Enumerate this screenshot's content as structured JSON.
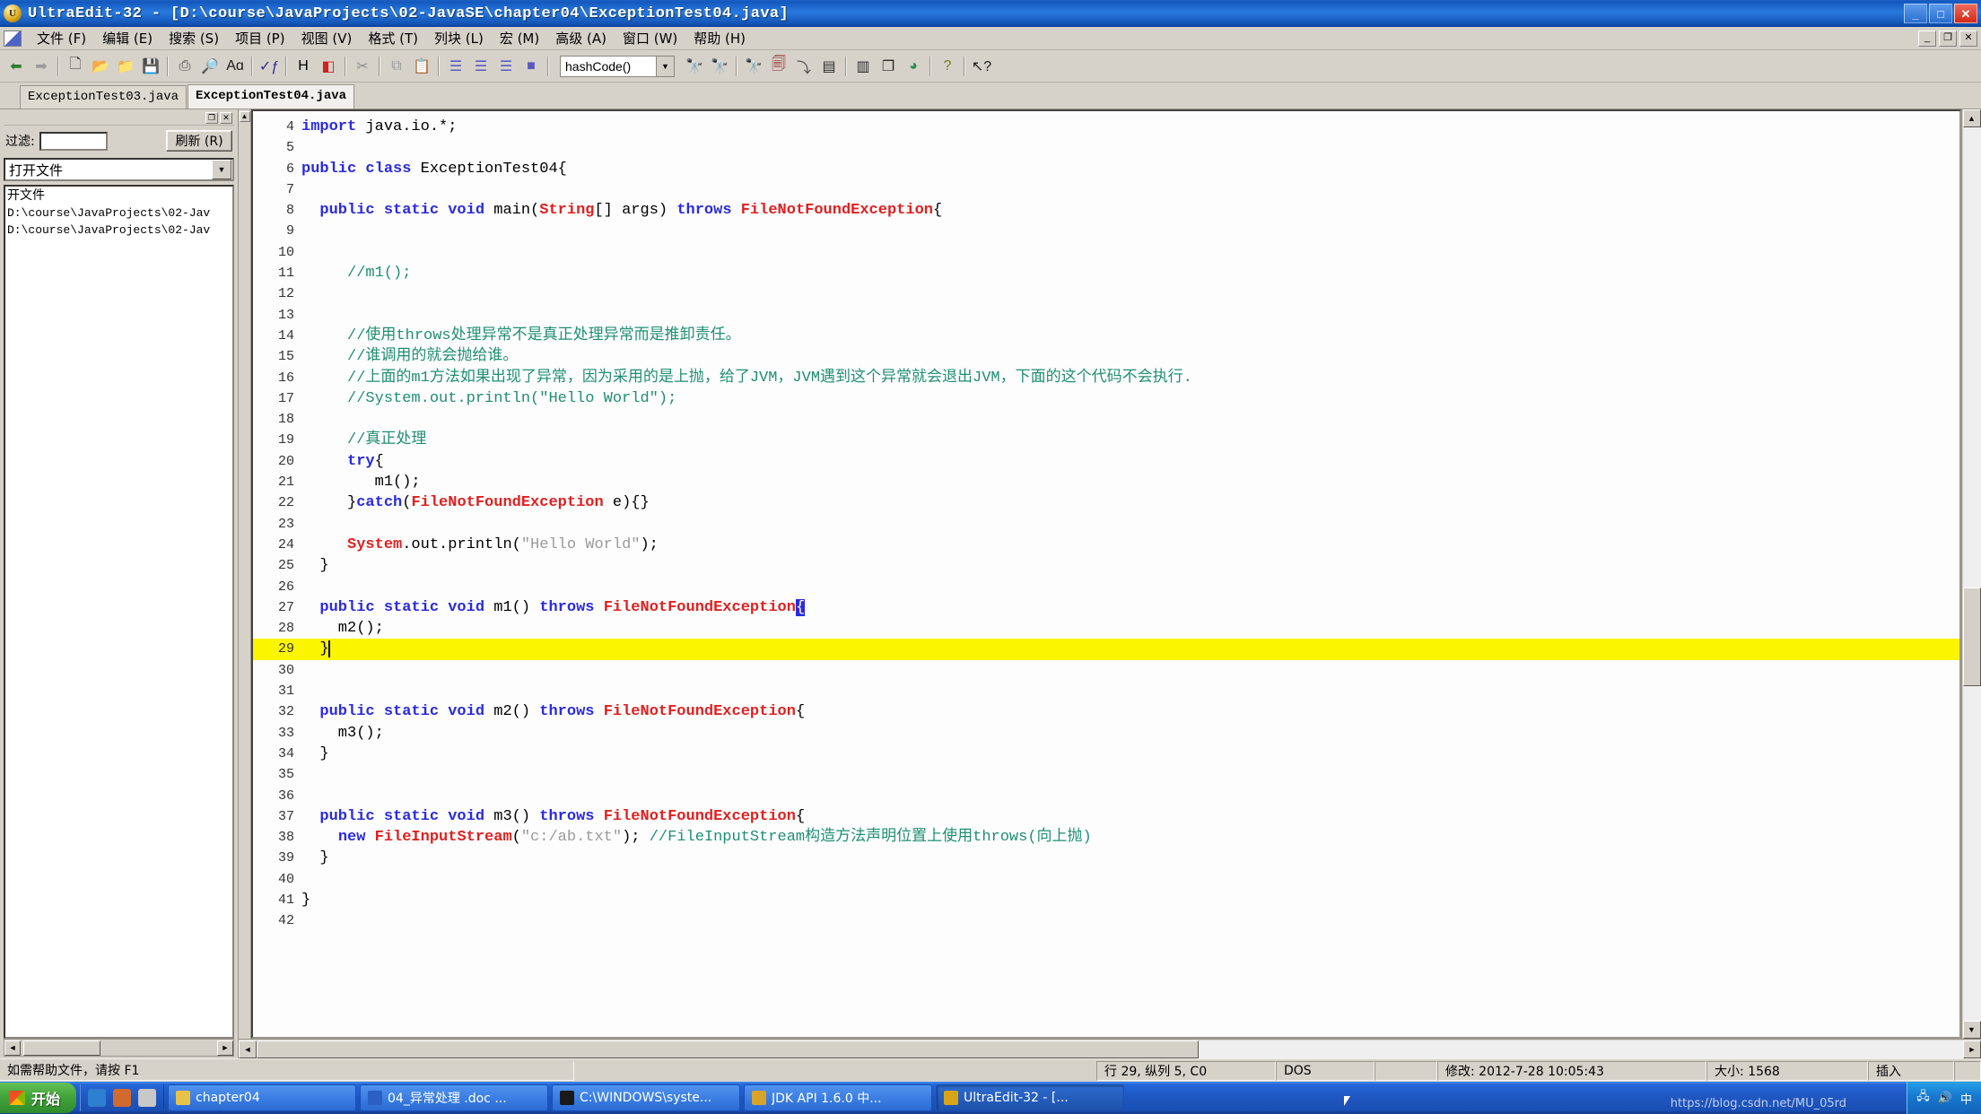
{
  "window": {
    "app_name": "UltraEdit-32",
    "title": "UltraEdit-32 - [D:\\course\\JavaProjects\\02-JavaSE\\chapter04\\ExceptionTest04.java]",
    "minimize_label": "_",
    "maximize_label": "□",
    "close_label": "✕",
    "doc_minimize_label": "_",
    "doc_restore_label": "❐",
    "doc_close_label": "✕"
  },
  "menu": {
    "items": [
      {
        "label": "文件 (F)",
        "name": "menu-file"
      },
      {
        "label": "编辑 (E)",
        "name": "menu-edit"
      },
      {
        "label": "搜索 (S)",
        "name": "menu-search"
      },
      {
        "label": "项目 (P)",
        "name": "menu-project"
      },
      {
        "label": "视图 (V)",
        "name": "menu-view"
      },
      {
        "label": "格式 (T)",
        "name": "menu-format"
      },
      {
        "label": "列块 (L)",
        "name": "menu-column"
      },
      {
        "label": "宏 (M)",
        "name": "menu-macro"
      },
      {
        "label": "高级 (A)",
        "name": "menu-advanced"
      },
      {
        "label": "窗口 (W)",
        "name": "menu-window"
      },
      {
        "label": "帮助 (H)",
        "name": "menu-help"
      }
    ]
  },
  "toolbar": {
    "function_combo_value": "hashCode()",
    "function_combo_arrow": "▼",
    "icons": [
      {
        "name": "back-icon",
        "glyph": "⬅",
        "color": "#2f7d32"
      },
      {
        "name": "forward-icon",
        "glyph": "➡",
        "color": "#9a9a9a"
      },
      {
        "name": "new-file-icon",
        "glyph": "🗋",
        "color": "#3a3a3a"
      },
      {
        "name": "open-file-icon",
        "glyph": "📂",
        "color": "#b58a22"
      },
      {
        "name": "close-file-icon",
        "glyph": "📁",
        "color": "#8a7016"
      },
      {
        "name": "save-icon",
        "glyph": "💾",
        "color": "#8d8d8d"
      },
      {
        "name": "print-icon",
        "glyph": "⎙",
        "color": "#4a4a4a"
      },
      {
        "name": "print-preview-icon",
        "glyph": "🔎",
        "color": "#4a4a4a"
      },
      {
        "name": "font-icon",
        "glyph": "Aɑ",
        "color": "#1a1a1a"
      },
      {
        "name": "spellcheck-icon",
        "glyph": "✓ƒ",
        "color": "#2b2b8f"
      },
      {
        "name": "hex-edit-icon",
        "glyph": "H",
        "color": "#000000"
      },
      {
        "name": "color-marker-icon",
        "glyph": "◧",
        "color": "#cc2222"
      },
      {
        "name": "cut-icon",
        "glyph": "✂",
        "color": "#8d8d8d"
      },
      {
        "name": "copy-icon",
        "glyph": "⧉",
        "color": "#9a9a9a"
      },
      {
        "name": "paste-icon",
        "glyph": "📋",
        "color": "#6f7a2a"
      },
      {
        "name": "align-left-icon",
        "glyph": "☰",
        "color": "#5a5ac0"
      },
      {
        "name": "align-center-icon",
        "glyph": "☰",
        "color": "#5a5ac0"
      },
      {
        "name": "align-right-icon",
        "glyph": "☰",
        "color": "#5a5ac0"
      },
      {
        "name": "align-justify-icon",
        "glyph": "■",
        "color": "#5a5ac0"
      },
      {
        "name": "find-icon",
        "glyph": "🔭",
        "color": "#1a1a6e"
      },
      {
        "name": "find-next-icon",
        "glyph": "🔭",
        "color": "#1a3a9e"
      },
      {
        "name": "find-prev-icon",
        "glyph": "🔭",
        "color": "#1a3a9e"
      },
      {
        "name": "replace-icon",
        "glyph": "🗐",
        "color": "#8b1a1a"
      },
      {
        "name": "goto-line-icon",
        "glyph": "⤵",
        "color": "#4a4a4a"
      },
      {
        "name": "split-horizontal-icon",
        "glyph": "▤",
        "color": "#2a2a2a"
      },
      {
        "name": "split-vertical-icon",
        "glyph": "▥",
        "color": "#2a2a2a"
      },
      {
        "name": "cascade-windows-icon",
        "glyph": "❐",
        "color": "#2a2a2a"
      },
      {
        "name": "color-palette-icon",
        "glyph": "◕",
        "color": "#2f8f4f"
      },
      {
        "name": "help-icon",
        "glyph": "?",
        "color": "#7a7a1a"
      },
      {
        "name": "context-help-icon",
        "glyph": "↖?",
        "color": "#1a1a1a"
      }
    ]
  },
  "file_tabs": [
    {
      "label": "ExceptionTest03.java",
      "active": false
    },
    {
      "label": "ExceptionTest04.java",
      "active": true
    }
  ],
  "sidebar": {
    "filter_label": "过滤:",
    "filter_value": "",
    "refresh_label": "刷新 (R)",
    "view_select_value": "打开文件",
    "view_select_arrow": "▼",
    "list_header": "开文件",
    "list_items": [
      "D:\\course\\JavaProjects\\02-Jav",
      "D:\\course\\JavaProjects\\02-Jav"
    ],
    "scroll_left_arrow": "◄",
    "scroll_right_arrow": "►"
  },
  "editor": {
    "first_visible_line": 4,
    "highlighted_line": 29,
    "lines": [
      {
        "n": 4,
        "tokens": [
          {
            "t": "import",
            "c": "kw"
          },
          {
            "t": " java.io.*;",
            "c": ""
          }
        ]
      },
      {
        "n": 5,
        "tokens": []
      },
      {
        "n": 6,
        "tokens": [
          {
            "t": "public class",
            "c": "kw"
          },
          {
            "t": " ExceptionTest04{",
            "c": ""
          }
        ]
      },
      {
        "n": 7,
        "tokens": []
      },
      {
        "n": 8,
        "tokens": [
          {
            "t": "  ",
            "c": ""
          },
          {
            "t": "public static void",
            "c": "kw"
          },
          {
            "t": " main(",
            "c": ""
          },
          {
            "t": "String",
            "c": "ty"
          },
          {
            "t": "[] args) ",
            "c": ""
          },
          {
            "t": "throws",
            "c": "kw"
          },
          {
            "t": " ",
            "c": ""
          },
          {
            "t": "FileNotFoundException",
            "c": "ty"
          },
          {
            "t": "{",
            "c": ""
          }
        ]
      },
      {
        "n": 9,
        "tokens": []
      },
      {
        "n": 10,
        "tokens": []
      },
      {
        "n": 11,
        "tokens": [
          {
            "t": "     //m1();",
            "c": "cm"
          }
        ]
      },
      {
        "n": 12,
        "tokens": []
      },
      {
        "n": 13,
        "tokens": []
      },
      {
        "n": 14,
        "tokens": [
          {
            "t": "     //使用throws处理异常不是真正处理异常而是推卸责任。",
            "c": "cm"
          }
        ]
      },
      {
        "n": 15,
        "tokens": [
          {
            "t": "     //谁调用的就会抛给谁。",
            "c": "cm"
          }
        ]
      },
      {
        "n": 16,
        "tokens": [
          {
            "t": "     //上面的m1方法如果出现了异常，因为采用的是上抛，给了JVM，JVM遇到这个异常就会退出JVM，下面的这个代码不会执行.",
            "c": "cm"
          }
        ]
      },
      {
        "n": 17,
        "tokens": [
          {
            "t": "     //System.out.println(\"Hello World\");",
            "c": "cm"
          }
        ]
      },
      {
        "n": 18,
        "tokens": []
      },
      {
        "n": 19,
        "tokens": [
          {
            "t": "     //真正处理",
            "c": "cm"
          }
        ]
      },
      {
        "n": 20,
        "tokens": [
          {
            "t": "     ",
            "c": ""
          },
          {
            "t": "try",
            "c": "kw"
          },
          {
            "t": "{",
            "c": ""
          }
        ]
      },
      {
        "n": 21,
        "tokens": [
          {
            "t": "        m1();",
            "c": ""
          }
        ]
      },
      {
        "n": 22,
        "tokens": [
          {
            "t": "     }",
            "c": ""
          },
          {
            "t": "catch",
            "c": "kw"
          },
          {
            "t": "(",
            "c": ""
          },
          {
            "t": "FileNotFoundException",
            "c": "ty"
          },
          {
            "t": " e){}",
            "c": ""
          }
        ]
      },
      {
        "n": 23,
        "tokens": []
      },
      {
        "n": 24,
        "tokens": [
          {
            "t": "     ",
            "c": ""
          },
          {
            "t": "System",
            "c": "ty"
          },
          {
            "t": ".out.println(",
            "c": ""
          },
          {
            "t": "\"Hello World\"",
            "c": "st"
          },
          {
            "t": ");",
            "c": ""
          }
        ]
      },
      {
        "n": 25,
        "tokens": [
          {
            "t": "  }",
            "c": ""
          }
        ]
      },
      {
        "n": 26,
        "tokens": []
      },
      {
        "n": 27,
        "tokens": [
          {
            "t": "  ",
            "c": ""
          },
          {
            "t": "public static void",
            "c": "kw"
          },
          {
            "t": " m1() ",
            "c": ""
          },
          {
            "t": "throws",
            "c": "kw"
          },
          {
            "t": " ",
            "c": ""
          },
          {
            "t": "FileNotFoundException",
            "c": "ty"
          },
          {
            "t": "{",
            "c": "caret-blk"
          }
        ]
      },
      {
        "n": 28,
        "tokens": [
          {
            "t": "    m2();",
            "c": ""
          }
        ]
      },
      {
        "n": 29,
        "tokens": [
          {
            "t": "  }",
            "c": ""
          }
        ]
      },
      {
        "n": 30,
        "tokens": []
      },
      {
        "n": 31,
        "tokens": []
      },
      {
        "n": 32,
        "tokens": [
          {
            "t": "  ",
            "c": ""
          },
          {
            "t": "public static void",
            "c": "kw"
          },
          {
            "t": " m2() ",
            "c": ""
          },
          {
            "t": "throws",
            "c": "kw"
          },
          {
            "t": " ",
            "c": ""
          },
          {
            "t": "FileNotFoundException",
            "c": "ty"
          },
          {
            "t": "{",
            "c": ""
          }
        ]
      },
      {
        "n": 33,
        "tokens": [
          {
            "t": "    m3();",
            "c": ""
          }
        ]
      },
      {
        "n": 34,
        "tokens": [
          {
            "t": "  }",
            "c": ""
          }
        ]
      },
      {
        "n": 35,
        "tokens": []
      },
      {
        "n": 36,
        "tokens": []
      },
      {
        "n": 37,
        "tokens": [
          {
            "t": "  ",
            "c": ""
          },
          {
            "t": "public static void",
            "c": "kw"
          },
          {
            "t": " m3() ",
            "c": ""
          },
          {
            "t": "throws",
            "c": "kw"
          },
          {
            "t": " ",
            "c": ""
          },
          {
            "t": "FileNotFoundException",
            "c": "ty"
          },
          {
            "t": "{",
            "c": ""
          }
        ]
      },
      {
        "n": 38,
        "tokens": [
          {
            "t": "    ",
            "c": ""
          },
          {
            "t": "new",
            "c": "kw"
          },
          {
            "t": " ",
            "c": ""
          },
          {
            "t": "FileInputStream",
            "c": "ty"
          },
          {
            "t": "(",
            "c": ""
          },
          {
            "t": "\"c:/ab.txt\"",
            "c": "st"
          },
          {
            "t": "); ",
            "c": ""
          },
          {
            "t": "//FileInputStream构造方法声明位置上使用throws(向上抛)",
            "c": "cm"
          }
        ]
      },
      {
        "n": 39,
        "tokens": [
          {
            "t": "  }",
            "c": ""
          }
        ]
      },
      {
        "n": 40,
        "tokens": []
      },
      {
        "n": 41,
        "tokens": [
          {
            "t": "}",
            "c": ""
          }
        ]
      },
      {
        "n": 42,
        "tokens": []
      }
    ]
  },
  "statusbar": {
    "hint": "如需帮助文件，请按 F1",
    "caret": "行 29, 纵列 5, C0",
    "line_ending": "DOS",
    "modified": "修改: 2012-7-28 10:05:43",
    "size": "大小: 1568",
    "insert_mode": "插入"
  },
  "taskbar": {
    "start_label": "开始",
    "quick_launch": [
      {
        "name": "ie-icon",
        "color": "#2f7fd0"
      },
      {
        "name": "media-player-icon",
        "color": "#d06a2f"
      },
      {
        "name": "show-desktop-icon",
        "color": "#c8c8c8"
      }
    ],
    "tasks": [
      {
        "label": "chapter04",
        "icon_color": "#e8c14a",
        "active": false,
        "icon_name": "folder-icon"
      },
      {
        "label": "04_异常处理 .doc ...",
        "icon_color": "#2a5fc4",
        "active": false,
        "icon_name": "word-doc-icon"
      },
      {
        "label": "C:\\WINDOWS\\syste...",
        "icon_color": "#1a1a1a",
        "active": false,
        "icon_name": "console-icon"
      },
      {
        "label": "JDK API 1.6.0 中...",
        "icon_color": "#d8a32a",
        "active": false,
        "icon_name": "help-file-icon"
      },
      {
        "label": "UltraEdit-32 - [...",
        "icon_color": "#d8a417",
        "active": true,
        "icon_name": "ultraedit-icon"
      }
    ],
    "tray": {
      "icons": [
        {
          "name": "network-icon",
          "glyph": "🖧"
        },
        {
          "name": "volume-icon",
          "glyph": "🔊"
        },
        {
          "name": "language-bar-icon",
          "glyph": "中"
        }
      ],
      "clock": ""
    },
    "watermark": "https://blog.csdn.net/MU_05rd"
  }
}
